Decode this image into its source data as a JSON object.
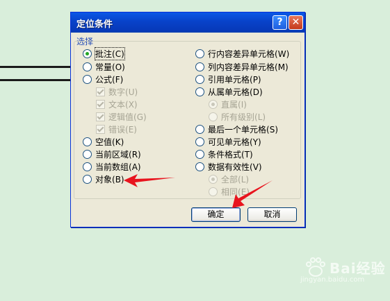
{
  "dialog": {
    "title": "定位条件",
    "help_glyph": "?",
    "close_glyph": "✕",
    "group_label": "选择",
    "ok_label": "确定",
    "cancel_label": "取消"
  },
  "left_options": [
    {
      "label": "批注",
      "key": "(C)",
      "selected": true
    },
    {
      "label": "常量",
      "key": "(O)"
    },
    {
      "label": "公式",
      "key": "(F)"
    },
    {
      "label": "空值",
      "key": "(K)"
    },
    {
      "label": "当前区域",
      "key": "(R)"
    },
    {
      "label": "当前数组",
      "key": "(A)"
    },
    {
      "label": "对象",
      "key": "(B)"
    }
  ],
  "formula_suboptions": [
    {
      "label": "数字",
      "key": "(U)",
      "checked": true
    },
    {
      "label": "文本",
      "key": "(X)",
      "checked": true
    },
    {
      "label": "逻辑值",
      "key": "(G)",
      "checked": true
    },
    {
      "label": "错误",
      "key": "(E)",
      "checked": true
    }
  ],
  "right_options": [
    {
      "label": "行内容差异单元格",
      "key": "(W)"
    },
    {
      "label": "列内容差异单元格",
      "key": "(M)"
    },
    {
      "label": "引用单元格",
      "key": "(P)"
    },
    {
      "label": "从属单元格",
      "key": "(D)"
    },
    {
      "label": "最后一个单元格",
      "key": "(S)"
    },
    {
      "label": "可见单元格",
      "key": "(Y)"
    },
    {
      "label": "条件格式",
      "key": "(T)"
    },
    {
      "label": "数据有效性",
      "key": "(V)"
    }
  ],
  "dependents_suboptions": [
    {
      "label": "直属",
      "key": "(I)",
      "selected": true
    },
    {
      "label": "所有级别",
      "key": "(L)"
    }
  ],
  "validation_suboptions": [
    {
      "label": "全部",
      "key": "(L)",
      "selected": true
    },
    {
      "label": "相同",
      "key": "(E)"
    }
  ],
  "annotations": {
    "arrow_color": "#e8141e"
  },
  "watermark": {
    "text": "Bai经验",
    "sub": "jingyan.baidu.com"
  }
}
